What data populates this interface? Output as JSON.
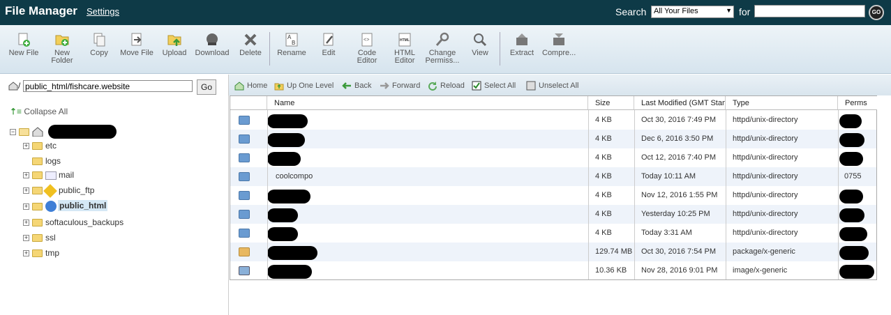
{
  "header": {
    "app_title": "File Manager",
    "settings_label": "Settings",
    "search_label": "Search",
    "search_scope": "All Your Files",
    "for_label": "for",
    "search_value": "",
    "go_label": "GO"
  },
  "toolbar": [
    {
      "label": "New File",
      "icon": "new-file-icon"
    },
    {
      "label": "New Folder",
      "icon": "new-folder-icon"
    },
    {
      "label": "Copy",
      "icon": "copy-icon"
    },
    {
      "label": "Move File",
      "icon": "move-file-icon"
    },
    {
      "label": "Upload",
      "icon": "upload-icon"
    },
    {
      "label": "Download",
      "icon": "download-icon"
    },
    {
      "label": "Delete",
      "icon": "delete-icon"
    },
    {
      "label": "Rename",
      "icon": "rename-icon"
    },
    {
      "label": "Edit",
      "icon": "edit-icon"
    },
    {
      "label": "Code Editor",
      "icon": "code-editor-icon"
    },
    {
      "label": "HTML Editor",
      "icon": "html-editor-icon"
    },
    {
      "label": "Change Permiss...",
      "icon": "permissions-icon"
    },
    {
      "label": "View",
      "icon": "view-icon"
    },
    {
      "label": "Extract",
      "icon": "extract-icon"
    },
    {
      "label": "Compre...",
      "icon": "compress-icon"
    }
  ],
  "path": {
    "separator": "/",
    "value": "public_html/fishcare.website",
    "go_label": "Go"
  },
  "tree": {
    "collapse_label": "Collapse All",
    "items": [
      {
        "label": "etc"
      },
      {
        "label": "logs"
      },
      {
        "label": "mail"
      },
      {
        "label": "public_ftp"
      },
      {
        "label": "public_html"
      },
      {
        "label": "softaculous_backups"
      },
      {
        "label": "ssl"
      },
      {
        "label": "tmp"
      }
    ]
  },
  "nav": {
    "home": "Home",
    "up": "Up One Level",
    "back": "Back",
    "forward": "Forward",
    "reload": "Reload",
    "select_all": "Select All",
    "unselect_all": "Unselect All"
  },
  "table": {
    "columns": [
      "Name",
      "Size",
      "Last Modified (GMT Standard Time)",
      "Type",
      "Perms"
    ],
    "rows": [
      {
        "name": "",
        "size": "4 KB",
        "modified": "Oct 30, 2016 7:49 PM",
        "type": "httpd/unix-directory",
        "perms": "",
        "kind": "folder"
      },
      {
        "name": "",
        "size": "4 KB",
        "modified": "Dec 6, 2016 3:50 PM",
        "type": "httpd/unix-directory",
        "perms": "",
        "kind": "folder"
      },
      {
        "name": "",
        "size": "4 KB",
        "modified": "Oct 12, 2016 7:40 PM",
        "type": "httpd/unix-directory",
        "perms": "",
        "kind": "folder"
      },
      {
        "name": "coolcompo",
        "size": "4 KB",
        "modified": "Today 10:11 AM",
        "type": "httpd/unix-directory",
        "perms": "0755",
        "kind": "folder"
      },
      {
        "name": "",
        "size": "4 KB",
        "modified": "Nov 12, 2016 1:55 PM",
        "type": "httpd/unix-directory",
        "perms": "",
        "kind": "folder"
      },
      {
        "name": "",
        "size": "4 KB",
        "modified": "Yesterday 10:25 PM",
        "type": "httpd/unix-directory",
        "perms": "",
        "kind": "folder"
      },
      {
        "name": "",
        "size": "4 KB",
        "modified": "Today 3:31 AM",
        "type": "httpd/unix-directory",
        "perms": "",
        "kind": "folder"
      },
      {
        "name": "",
        "size": "129.74 MB",
        "modified": "Oct 30, 2016 7:54 PM",
        "type": "package/x-generic",
        "perms": "",
        "kind": "package"
      },
      {
        "name": "",
        "size": "10.36 KB",
        "modified": "Nov 28, 2016 9:01 PM",
        "type": "image/x-generic",
        "perms": "",
        "kind": "image"
      }
    ]
  }
}
